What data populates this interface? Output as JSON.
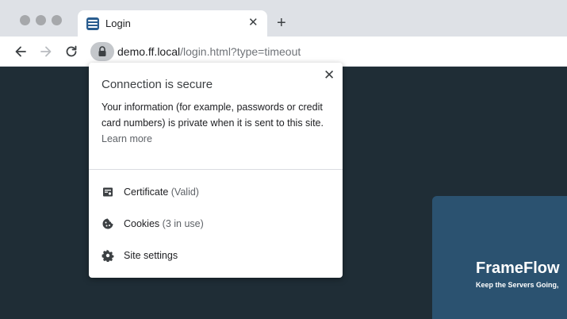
{
  "browser": {
    "tab": {
      "title": "Login",
      "close_glyph": "✕",
      "favicon": "frameflow-logo-icon"
    },
    "new_tab_glyph": "+",
    "address": {
      "domain": "demo.ff.local",
      "path": "/login.html?type=timeout"
    },
    "icons": {
      "back": "arrow-left-icon",
      "forward": "arrow-right-icon",
      "reload": "reload-icon",
      "lock": "lock-icon"
    }
  },
  "popup": {
    "title": "Connection is secure",
    "close_glyph": "✕",
    "description": "Your information (for example, passwords or credit card numbers) is private when it is sent to this site.",
    "learn_more": "Learn more",
    "items": [
      {
        "label": "Certificate",
        "detail": "(Valid)",
        "icon": "certificate-icon"
      },
      {
        "label": "Cookies",
        "detail": "(3 in use)",
        "icon": "cookie-icon"
      },
      {
        "label": "Site settings",
        "detail": "",
        "icon": "gear-icon"
      }
    ]
  },
  "page": {
    "brand": "FrameFlow",
    "tagline": "Keep the Servers Going,"
  },
  "colors": {
    "page_background": "#1f2d36",
    "card_background": "#2b5270",
    "tabstrip": "#dee1e6"
  }
}
